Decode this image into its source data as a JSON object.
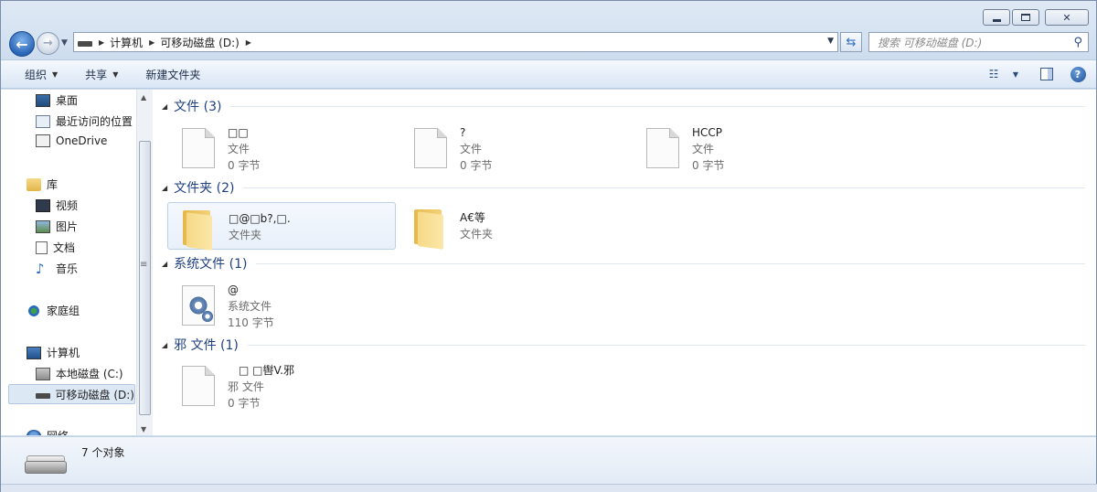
{
  "window": {
    "caption_buttons": [
      "minimize",
      "maximize",
      "close"
    ]
  },
  "address_bar": {
    "crumbs": [
      "计算机",
      "可移动磁盘 (D:)"
    ]
  },
  "search": {
    "placeholder": "搜索 可移动磁盘 (D:)"
  },
  "toolbar": {
    "organize_label": "组织",
    "share_label": "共享",
    "new_folder_label": "新建文件夹"
  },
  "nav": {
    "items": [
      {
        "label": "桌面",
        "icon": "desktop-icon"
      },
      {
        "label": "最近访问的位置",
        "icon": "recent-places-icon"
      },
      {
        "label": "OneDrive",
        "icon": "onedrive-icon"
      },
      {
        "label": "库",
        "icon": "libraries-icon"
      },
      {
        "label": "视频",
        "icon": "video-icon"
      },
      {
        "label": "图片",
        "icon": "pictures-icon"
      },
      {
        "label": "文档",
        "icon": "documents-icon"
      },
      {
        "label": "音乐",
        "icon": "music-icon"
      },
      {
        "label": "家庭组",
        "icon": "homegroup-icon"
      },
      {
        "label": "计算机",
        "icon": "computer-icon"
      },
      {
        "label": "本地磁盘 (C:)",
        "icon": "local-disk-icon"
      },
      {
        "label": "可移动磁盘 (D:)",
        "icon": "removable-drive-icon"
      },
      {
        "label": "网络",
        "icon": "network-icon"
      }
    ]
  },
  "groups": [
    {
      "title": "文件 (3)",
      "items": [
        {
          "name": "□□",
          "type": "文件",
          "size": "0 字节"
        },
        {
          "name": "?",
          "type": "文件",
          "size": "0 字节"
        },
        {
          "name": "HCCP",
          "type": "文件",
          "size": "0 字节"
        }
      ]
    },
    {
      "title": "文件夹 (2)",
      "items": [
        {
          "name": "□@□b?,□.",
          "type": "文件夹"
        },
        {
          "name": "A€等",
          "type": "文件夹"
        }
      ]
    },
    {
      "title": "系统文件 (1)",
      "items": [
        {
          "name": "@",
          "type": "系统文件",
          "size": "110 字节"
        }
      ]
    },
    {
      "title": "邪 文件 (1)",
      "items": [
        {
          "name": "□ □辔V.邪",
          "type": "邪 文件",
          "size": "0 字节"
        }
      ]
    }
  ],
  "status": {
    "count_text": "7 个对象"
  }
}
